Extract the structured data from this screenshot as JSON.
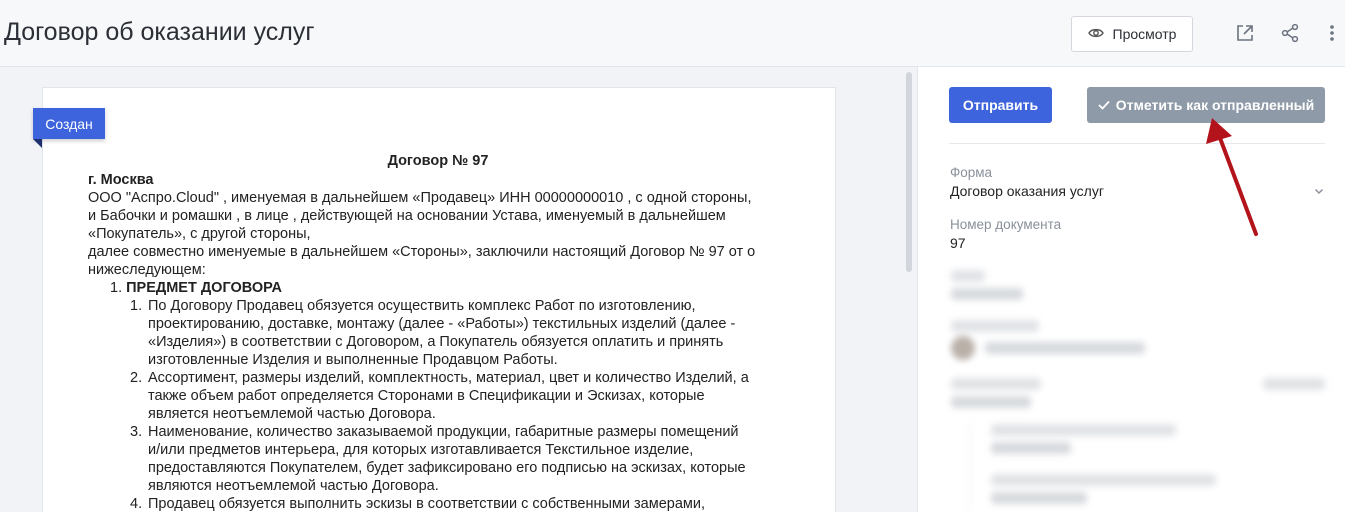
{
  "header": {
    "title": "Договор об оказании услуг",
    "preview_label": "Просмотр"
  },
  "document": {
    "status": "Создан",
    "heading": "Договор № 97",
    "city": "г. Москва",
    "intro": [
      "ООО \"Аспро.Cloud\" , именуемая в дальнейшем «Продавец» ИНН  00000000010 , с одной стороны,",
      "и Бабочки и ромашки , в лице , действующей на основании Устава, именуемый в дальнейшем",
      "«Покупатель», с другой стороны,",
      "далее совместно именуемые в дальнейшем «Стороны», заключили настоящий Договор № 97 от о",
      "нижеследующем:"
    ],
    "section": {
      "number": "1.",
      "title": "ПРЕДМЕТ ДОГОВОРА",
      "items": [
        {
          "number": "1.",
          "lines": [
            "По Договору Продавец обязуется осуществить комплекс Работ по изготовлению,",
            "проектированию, доставке, монтажу (далее - «Работы») текстильных изделий (далее -",
            "«Изделия») в соответствии с Договором, а Покупатель обязуется оплатить и принять",
            "изготовленные Изделия и выполненные Продавцом Работы."
          ]
        },
        {
          "number": "2.",
          "lines": [
            "Ассортимент, размеры изделий, комплектность, материал, цвет и количество Изделий, а",
            "также объем работ определяется Сторонами в Спецификации и Эскизах, которые",
            "является неотъемлемой частью Договора."
          ]
        },
        {
          "number": "3.",
          "lines": [
            "Наименование, количество заказываемой продукции, габаритные размеры помещений",
            "и/или предметов интерьера, для которых изготавливается Текстильное изделие,",
            "предоставляются Покупателем, будет зафиксировано его подписью на эскизах, которые",
            "являются неотъемлемой частью Договора."
          ]
        },
        {
          "number": "4.",
          "lines": [
            "Продавец обязуется выполнить эскизы в соответствии с собственными замерами,"
          ]
        }
      ]
    }
  },
  "sidebar": {
    "send_label": "Отправить",
    "mark_label": "Отметить как отправленный",
    "form_label": "Форма",
    "form_value": "Договор оказания услуг",
    "docnum_label": "Номер документа",
    "docnum_value": "97"
  },
  "colors": {
    "accent": "#3d63dd",
    "mark_button": "#8f9aa8",
    "annotation_arrow": "#b3141b"
  },
  "icons": [
    "eye-icon",
    "external-link-icon",
    "share-icon",
    "more-vertical-icon",
    "check-icon",
    "chevron-down-icon"
  ]
}
